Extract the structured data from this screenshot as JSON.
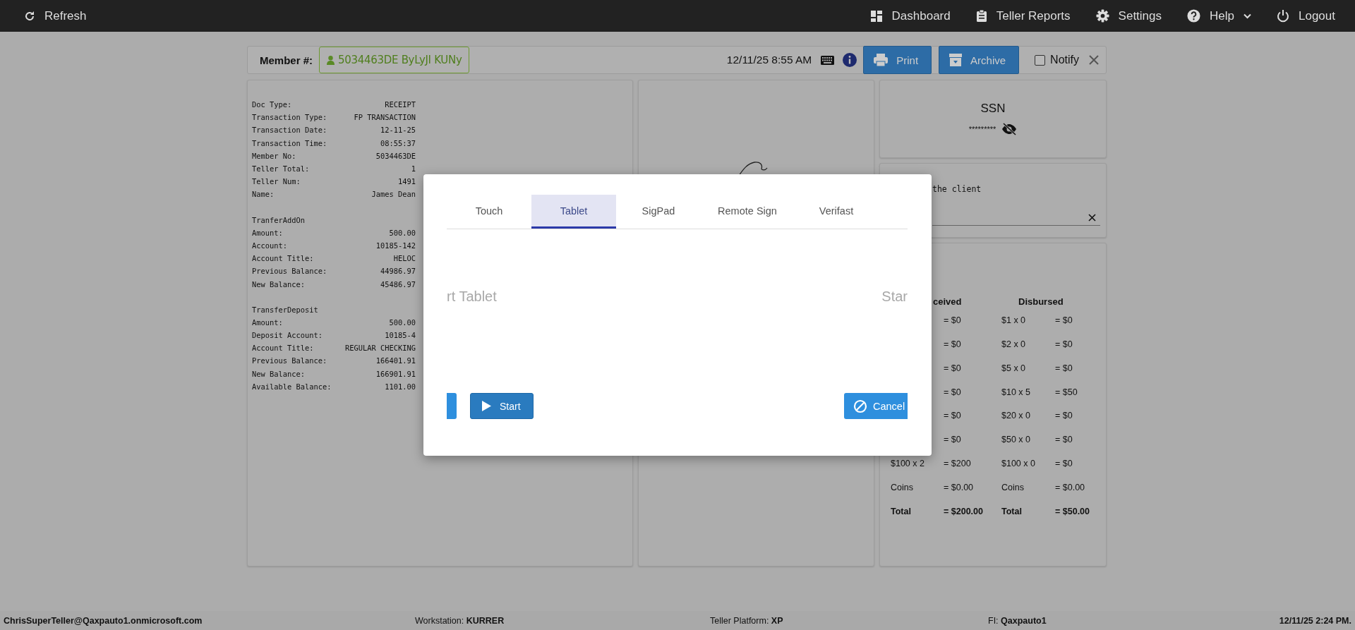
{
  "nav": {
    "left": [
      {
        "label": "Refresh",
        "kind": "refresh"
      }
    ],
    "right": [
      {
        "label": "Dashboard",
        "kind": "dashboard"
      },
      {
        "label": "Teller Reports",
        "kind": "reports"
      },
      {
        "label": "Settings",
        "kind": "settings"
      },
      {
        "label": "Help",
        "kind": "help",
        "dropdown": true
      },
      {
        "label": "Logout",
        "kind": "logout"
      }
    ]
  },
  "header": {
    "member_label": "Member #:",
    "member_value": "5034463DE ByLyJI KUNy",
    "datetime": "12/11/25 8:55 AM",
    "buttons": [
      {
        "label": "Print",
        "kind": "print"
      },
      {
        "label": "Archive",
        "kind": "archive"
      }
    ],
    "notify": {
      "label": "Notify",
      "checked": false
    }
  },
  "receipt": {
    "sections": [
      {
        "lines": [
          {
            "label": "Doc Type:",
            "value": "RECEIPT"
          },
          {
            "label": "Transaction Type:",
            "value": "FP TRANSACTION"
          },
          {
            "label": "Transaction Date:",
            "value": "12-11-25"
          },
          {
            "label": "Transaction Time:",
            "value": "08:55:37"
          },
          {
            "label": "Member No:",
            "value": "5034463DE"
          },
          {
            "label": "Teller Total:",
            "value": "1"
          },
          {
            "label": "Teller Num:",
            "value": "1491"
          },
          {
            "label": "Name:",
            "value": "James Dean"
          }
        ]
      },
      {
        "title": "TranferAddOn",
        "lines": [
          {
            "label": "Amount:",
            "value": "500.00"
          },
          {
            "label": "Account:",
            "value": "10185-142"
          },
          {
            "label": "Account Title:",
            "value": "HELOC"
          },
          {
            "label": "Previous Balance:",
            "value": "44986.97"
          },
          {
            "label": "New Balance:",
            "value": "45486.97"
          }
        ]
      },
      {
        "title": "TransferDeposit",
        "lines": [
          {
            "label": "Amount:",
            "value": "500.00"
          },
          {
            "label": "Deposit Account:",
            "value": "10185-4"
          },
          {
            "label": "Account Title:",
            "value": "REGULAR CHECKING"
          },
          {
            "label": "Previous Balance:",
            "value": "166401.91"
          },
          {
            "label": "New Balance:",
            "value": "166901.91"
          },
          {
            "label": "Available Balance:",
            "value": "1101.00"
          }
        ]
      }
    ]
  },
  "ssn": {
    "title": "SSN",
    "value": "*********"
  },
  "memo": {
    "text": "the client"
  },
  "denominations": {
    "received_heading": "ceived",
    "disbursed_heading": "Disbursed",
    "rows": [
      {
        "received": {
          "amount": "= $0"
        },
        "disbursed": {
          "label": "$1 x 0",
          "amount": "= $0"
        }
      },
      {
        "received": {
          "amount": "= $0"
        },
        "disbursed": {
          "label": "$2 x 0",
          "amount": "= $0"
        }
      },
      {
        "received": {
          "amount": "= $0"
        },
        "disbursed": {
          "label": "$5 x 0",
          "amount": "= $0"
        }
      },
      {
        "received": {
          "amount": "= $0"
        },
        "disbursed": {
          "label": "$10 x 5",
          "amount": "= $50"
        }
      },
      {
        "received": {
          "amount": "= $0"
        },
        "disbursed": {
          "label": "$20 x 0",
          "amount": "= $0"
        }
      },
      {
        "received": {
          "amount": "= $0"
        },
        "disbursed": {
          "label": "$50 x 0",
          "amount": "= $0"
        }
      },
      {
        "received": {
          "label": "$100 x 2",
          "amount": "= $200"
        },
        "disbursed": {
          "label": "$100 x 0",
          "amount": "= $0"
        }
      },
      {
        "received": {
          "label": "Coins",
          "amount": "= $0.00"
        },
        "disbursed": {
          "label": "Coins",
          "amount": "= $0.00"
        }
      },
      {
        "kind": "total",
        "received": {
          "label": "Total",
          "amount": "= $200.00"
        },
        "disbursed": {
          "label": "Total",
          "amount": "= $50.00"
        }
      }
    ]
  },
  "modal": {
    "tabs": [
      {
        "label": "Touch",
        "selected": false
      },
      {
        "label": "Tablet",
        "selected": true
      },
      {
        "label": "SigPad",
        "selected": false
      },
      {
        "label": "Remote Sign",
        "selected": false
      },
      {
        "label": "Verifast",
        "selected": false
      }
    ],
    "slide_left": "rt Tablet",
    "slide_right": "Star",
    "buttons": [
      {
        "kind": "partial"
      },
      {
        "label": "Start",
        "kind": "start"
      },
      {
        "label": "Cancel",
        "kind": "cancel"
      }
    ]
  },
  "status_bar": [
    {
      "text": "ChrisSuperTeller@Qaxpauto1.onmicrosoft.com",
      "bold": true
    },
    {
      "text": "Workstation: **KURRER**",
      "bold": false
    },
    {
      "text": "Teller Platform: **XP**",
      "bold": false
    },
    {
      "text": "FI: **Qaxpauto1**",
      "bold": false
    },
    {
      "text": "12/11/25 2:24 PM.",
      "bold": true
    }
  ]
}
